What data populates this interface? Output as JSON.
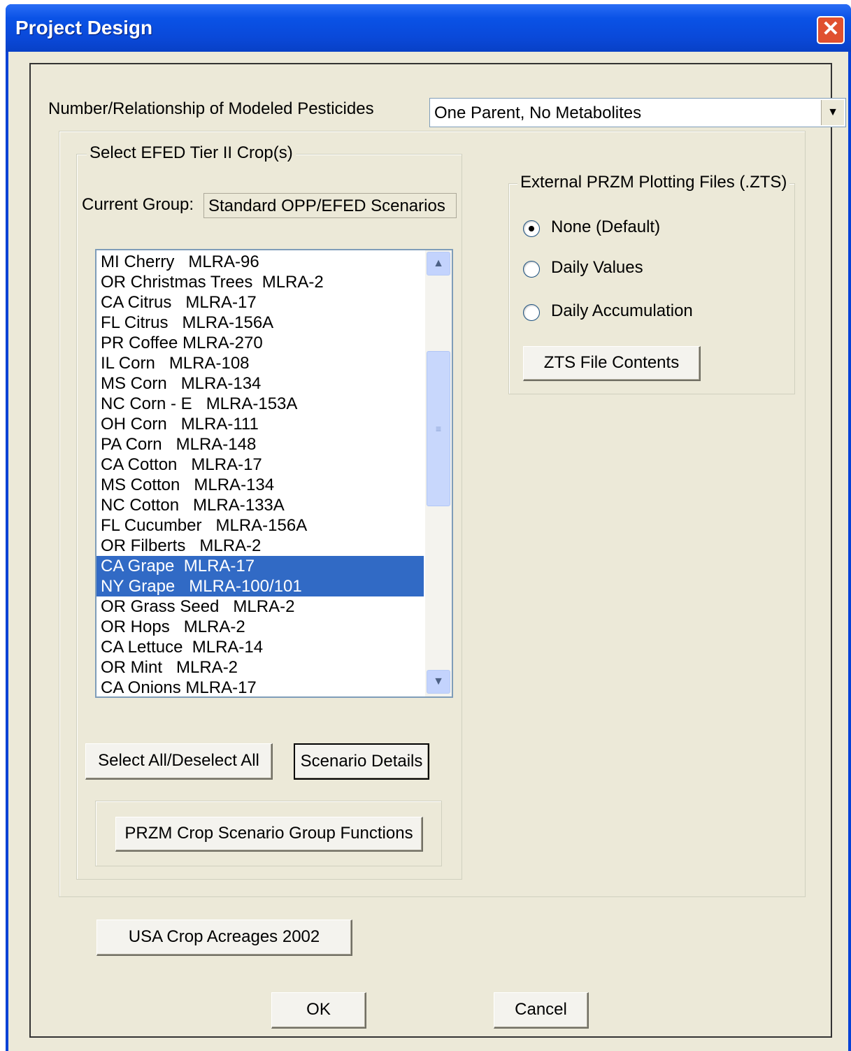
{
  "window": {
    "title": "Project Design",
    "close_glyph": "✕"
  },
  "pesticides": {
    "label": "Number/Relationship of Modeled Pesticides",
    "selected": "One Parent, No Metabolites",
    "dropdown_icon": "▼"
  },
  "crops": {
    "group_title": "Select EFED Tier II Crop(s)",
    "current_group_label": "Current Group:",
    "current_group_value": "Standard OPP/EFED Scenarios",
    "items": [
      {
        "label": "MI Cherry   MLRA-96",
        "selected": false
      },
      {
        "label": "OR Christmas Trees  MLRA-2",
        "selected": false
      },
      {
        "label": "CA Citrus   MLRA-17",
        "selected": false
      },
      {
        "label": "FL Citrus   MLRA-156A",
        "selected": false
      },
      {
        "label": "PR Coffee MLRA-270",
        "selected": false
      },
      {
        "label": "IL Corn   MLRA-108",
        "selected": false
      },
      {
        "label": "MS Corn   MLRA-134",
        "selected": false
      },
      {
        "label": "NC Corn - E   MLRA-153A",
        "selected": false
      },
      {
        "label": "OH Corn   MLRA-111",
        "selected": false
      },
      {
        "label": "PA Corn   MLRA-148",
        "selected": false
      },
      {
        "label": "CA Cotton   MLRA-17",
        "selected": false
      },
      {
        "label": "MS Cotton   MLRA-134",
        "selected": false
      },
      {
        "label": "NC Cotton   MLRA-133A",
        "selected": false
      },
      {
        "label": "FL Cucumber   MLRA-156A",
        "selected": false
      },
      {
        "label": "OR Filberts   MLRA-2",
        "selected": false
      },
      {
        "label": "CA Grape  MLRA-17",
        "selected": true
      },
      {
        "label": "NY Grape   MLRA-100/101",
        "selected": true
      },
      {
        "label": "OR Grass Seed   MLRA-2",
        "selected": false
      },
      {
        "label": "OR Hops   MLRA-2",
        "selected": false
      },
      {
        "label": "CA Lettuce  MLRA-14",
        "selected": false
      },
      {
        "label": "OR Mint   MLRA-2",
        "selected": false
      },
      {
        "label": "CA Onions MLRA-17",
        "selected": false
      }
    ],
    "scroll_up_icon": "▲",
    "scroll_down_icon": "▼",
    "thumb_grip_icon": "≡",
    "select_all_label": "Select All/Deselect All",
    "scenario_details_label": "Scenario Details",
    "group_functions_label": "PRZM Crop Scenario Group Functions"
  },
  "zts": {
    "group_title": "External PRZM Plotting Files (.ZTS)",
    "options": [
      {
        "label": "None (Default)",
        "checked": true
      },
      {
        "label": "Daily Values",
        "checked": false
      },
      {
        "label": "Daily Accumulation",
        "checked": false
      }
    ],
    "contents_button_label": "ZTS File Contents"
  },
  "acreages_button_label": "USA Crop Acreages 2002",
  "ok_label": "OK",
  "cancel_label": "Cancel"
}
